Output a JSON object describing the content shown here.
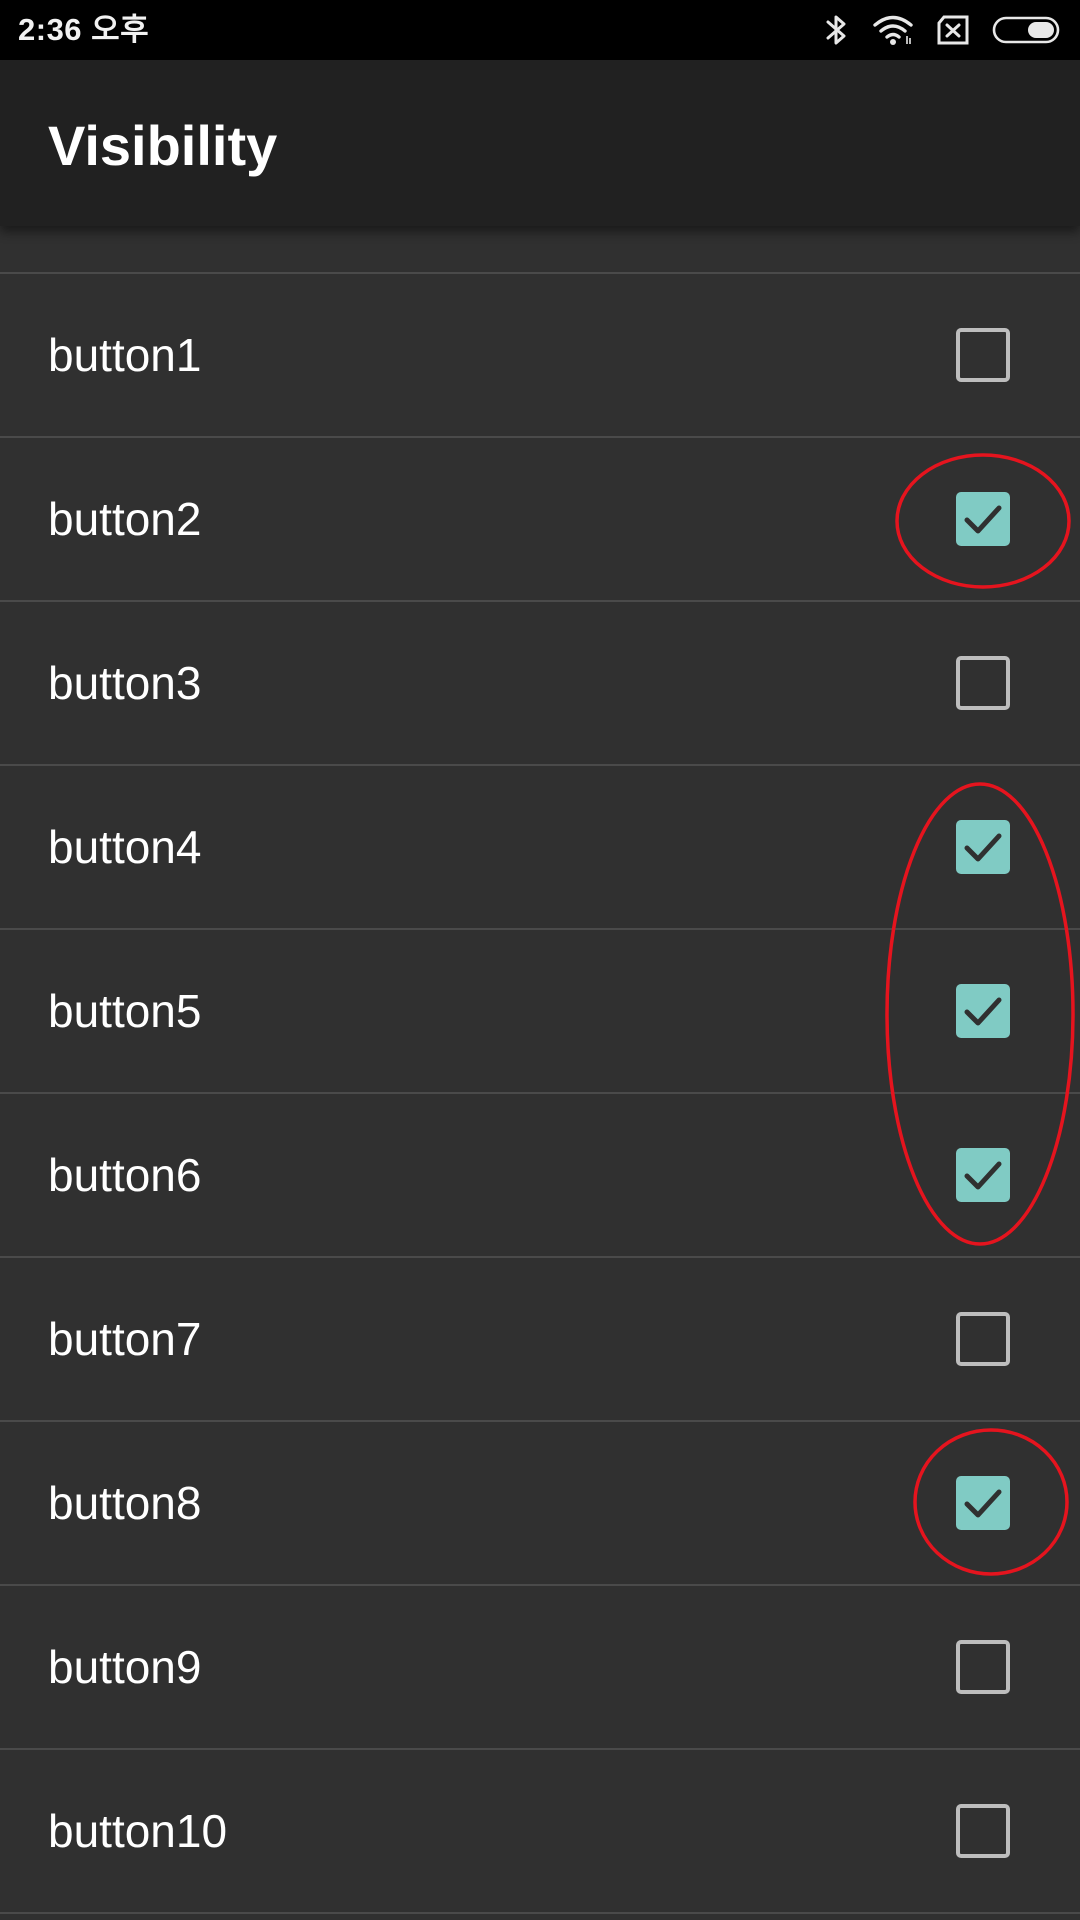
{
  "status_bar": {
    "time": "2:36 오후",
    "icons": [
      "bluetooth-icon",
      "wifi-icon",
      "no-sim-icon",
      "battery-icon"
    ]
  },
  "app_bar": {
    "title": "Visibility"
  },
  "items": [
    {
      "label": "button1",
      "checked": false
    },
    {
      "label": "button2",
      "checked": true
    },
    {
      "label": "button3",
      "checked": false
    },
    {
      "label": "button4",
      "checked": true
    },
    {
      "label": "button5",
      "checked": true
    },
    {
      "label": "button6",
      "checked": true
    },
    {
      "label": "button7",
      "checked": false
    },
    {
      "label": "button8",
      "checked": true
    },
    {
      "label": "button9",
      "checked": false
    },
    {
      "label": "button10",
      "checked": false
    }
  ],
  "colors": {
    "checked": "#80cbc4",
    "check_mark": "#303030",
    "unchecked_border": "#bdbdbd",
    "annotation": "#e5141e",
    "app_bar": "#212121",
    "background": "#303030"
  }
}
